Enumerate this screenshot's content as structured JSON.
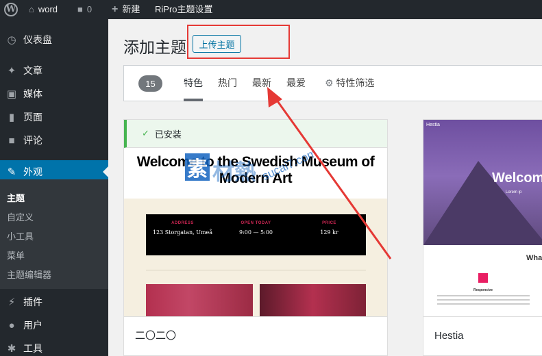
{
  "adminbar": {
    "site_name": "word",
    "comments_count": "0",
    "new_label": "新建",
    "riproset_label": "RiPro主题设置"
  },
  "sidebar": {
    "items": [
      {
        "label": "仪表盘",
        "icon": "dashboard-icon"
      },
      {
        "label": "文章",
        "icon": "pin-icon"
      },
      {
        "label": "媒体",
        "icon": "media-icon"
      },
      {
        "label": "页面",
        "icon": "page-icon"
      },
      {
        "label": "评论",
        "icon": "comment-icon"
      },
      {
        "label": "外观",
        "icon": "appearance-icon"
      },
      {
        "label": "插件",
        "icon": "plugin-icon"
      },
      {
        "label": "用户",
        "icon": "user-icon"
      },
      {
        "label": "工具",
        "icon": "wrench-icon"
      }
    ],
    "submenu": [
      "主题",
      "自定义",
      "小工具",
      "菜单",
      "主题编辑器"
    ]
  },
  "page": {
    "title": "添加主题",
    "upload_button": "上传主题"
  },
  "filter_bar": {
    "count": "15",
    "tabs": [
      "特色",
      "热门",
      "最新",
      "最爱"
    ],
    "feature_filter": "特性筛选"
  },
  "themes": [
    {
      "name": "二〇二〇",
      "installed_label": "已安装",
      "preview": {
        "headline": "Welcome to the Swedish Museum of Modern Art",
        "address_label": "ADDRESS",
        "address": "123 Storgatan, Umeå",
        "open_label": "OPEN TODAY",
        "open": "9:00 — 5:00",
        "price_label": "PRICE",
        "price": "129 kr"
      }
    },
    {
      "name": "Hestia",
      "preview": {
        "brand": "Hestia",
        "headline": "Welcom",
        "sub": "Lorem ip",
        "section": "What",
        "feature": "Responsive"
      }
    }
  ],
  "watermark": {
    "mark": "素",
    "zh": "材熱",
    "en": "sucai7.com"
  },
  "colors": {
    "accent": "#0073aa",
    "annotation": "#e53935",
    "installed": "#46b450"
  }
}
